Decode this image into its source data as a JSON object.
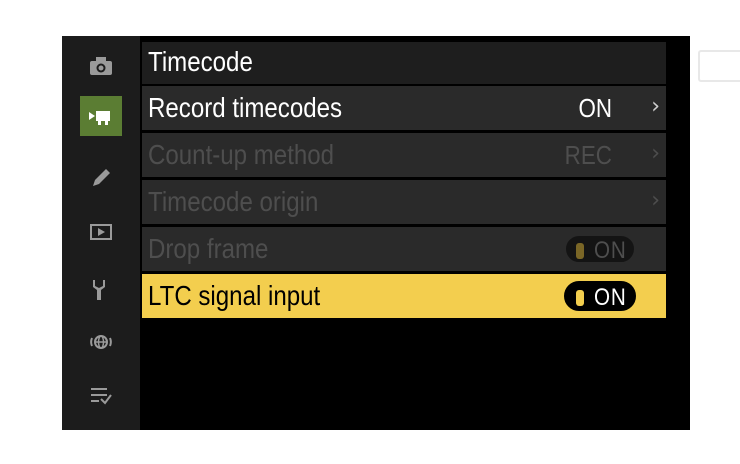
{
  "header": {
    "title": "Timecode",
    "back_icon": "return-icon"
  },
  "sidebar": {
    "items": [
      {
        "icon": "camera-icon"
      },
      {
        "icon": "movie-camera-icon",
        "active": true
      },
      {
        "icon": "pencil-icon"
      },
      {
        "icon": "playback-icon"
      },
      {
        "icon": "wrench-icon"
      },
      {
        "icon": "network-icon"
      },
      {
        "icon": "my-menu-icon"
      }
    ]
  },
  "menu": {
    "items": [
      {
        "label": "Record timecodes",
        "value": "ON",
        "enabled": true
      },
      {
        "label": "Count-up method",
        "value": "REC",
        "enabled": false
      },
      {
        "label": "Timecode origin",
        "value": "",
        "enabled": false
      },
      {
        "label": "Drop frame",
        "toggle": "ON",
        "enabled": false
      },
      {
        "label": "LTC signal input",
        "toggle": "ON",
        "enabled": true,
        "selected": true
      }
    ]
  },
  "colors": {
    "active_tab": "#5b7d33",
    "selection": "#f3ce4e",
    "disabled_text": "#4e4e4e",
    "background": "#000000"
  }
}
